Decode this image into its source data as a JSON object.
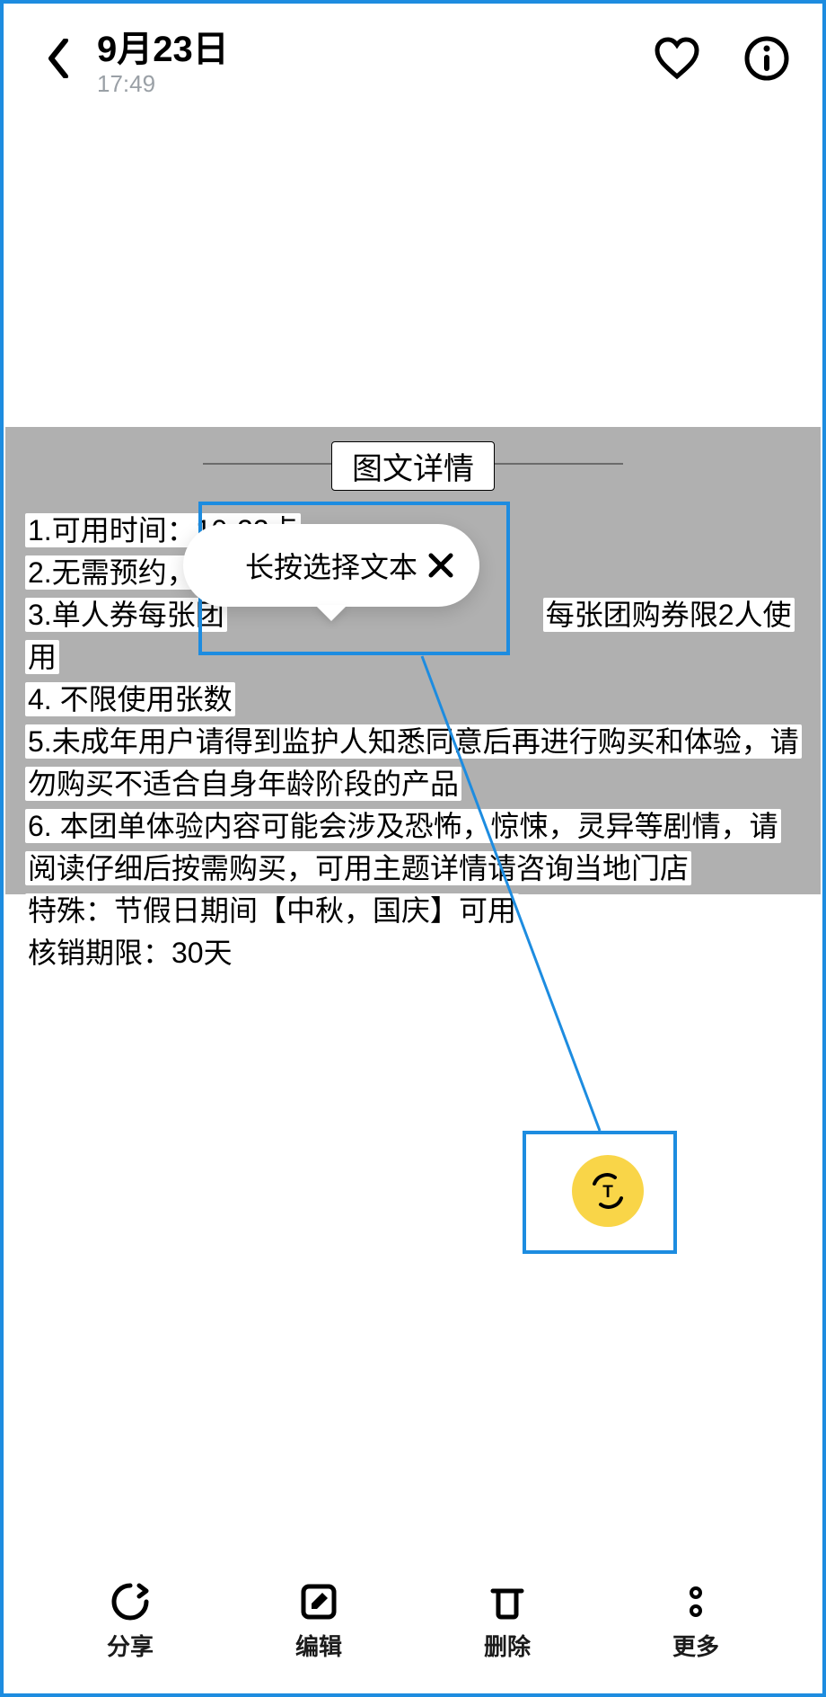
{
  "header": {
    "date": "9月23日",
    "time": "17:49"
  },
  "detail": {
    "title": "图文详情",
    "line1": "1.可用时间：10-22点",
    "line2": "2.无需预约，高",
    "line3a": "3.单人券每张团",
    "line3b": "每张团购券限2人使用",
    "line4": "4. 不限使用张数",
    "line5": "5.未成年用户请得到监护人知悉同意后再进行购买和体验，请勿购买不适合自身年龄阶段的产品",
    "line6": "6. 本团单体验内容可能会涉及恐怖，惊悚，灵异等剧情，请阅读仔细后按需购买，可用主题详情请咨询当地门店",
    "line7": "特殊：节假日期间【中秋，国庆】可用",
    "line8": "核销期限：30天"
  },
  "tooltip": {
    "text": "长按选择文本"
  },
  "toolbar": {
    "share": "分享",
    "edit": "编辑",
    "delete": "删除",
    "more": "更多"
  }
}
